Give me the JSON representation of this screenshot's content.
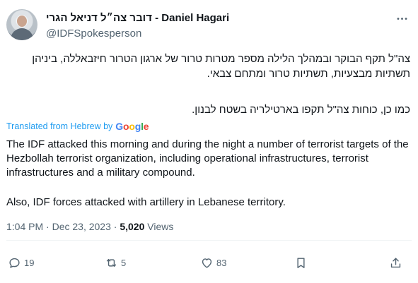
{
  "author": {
    "display_name": "דובר צה״ל דניאל הגרי - Daniel Hagari",
    "handle": "@IDFSpokesperson"
  },
  "tweet": {
    "hebrew_paragraph_1": "צה\"ל תקף הבוקר ובמהלך הלילה מספר מטרות טרור של ארגון הטרור חיזבאללה, ביניהן תשתיות מבצעיות, תשתיות טרור ומתחם צבאי.",
    "hebrew_paragraph_2": "כמו כן, כוחות צה\"ל תקפו בארטילריה בשטח לבנון.",
    "translated_label": "Translated from Hebrew by",
    "google_logo": {
      "g1": "G",
      "o1": "o",
      "o2": "o",
      "g2": "g",
      "l": "l",
      "e": "e"
    },
    "translation_paragraph_1": "The IDF attacked this morning and during the night a number of terrorist targets of the Hezbollah terrorist organization, including operational infrastructures, terrorist infrastructures and a military compound.",
    "translation_paragraph_2": "Also, IDF forces attacked with artillery in Lebanese territory."
  },
  "meta": {
    "time": "1:04 PM",
    "sep1": " · ",
    "date": "Dec 23, 2023",
    "sep2": " · ",
    "views_count": "5,020",
    "views_label": " Views"
  },
  "actions": {
    "reply_count": "19",
    "retweet_count": "5",
    "like_count": "83"
  },
  "icons": {
    "more": "more-icon",
    "reply": "reply-icon",
    "retweet": "retweet-icon",
    "like": "heart-icon",
    "bookmark": "bookmark-icon",
    "share": "share-icon"
  },
  "colors": {
    "link_blue": "#1d9bf0",
    "secondary_text": "#536471",
    "primary_text": "#0f1419"
  }
}
